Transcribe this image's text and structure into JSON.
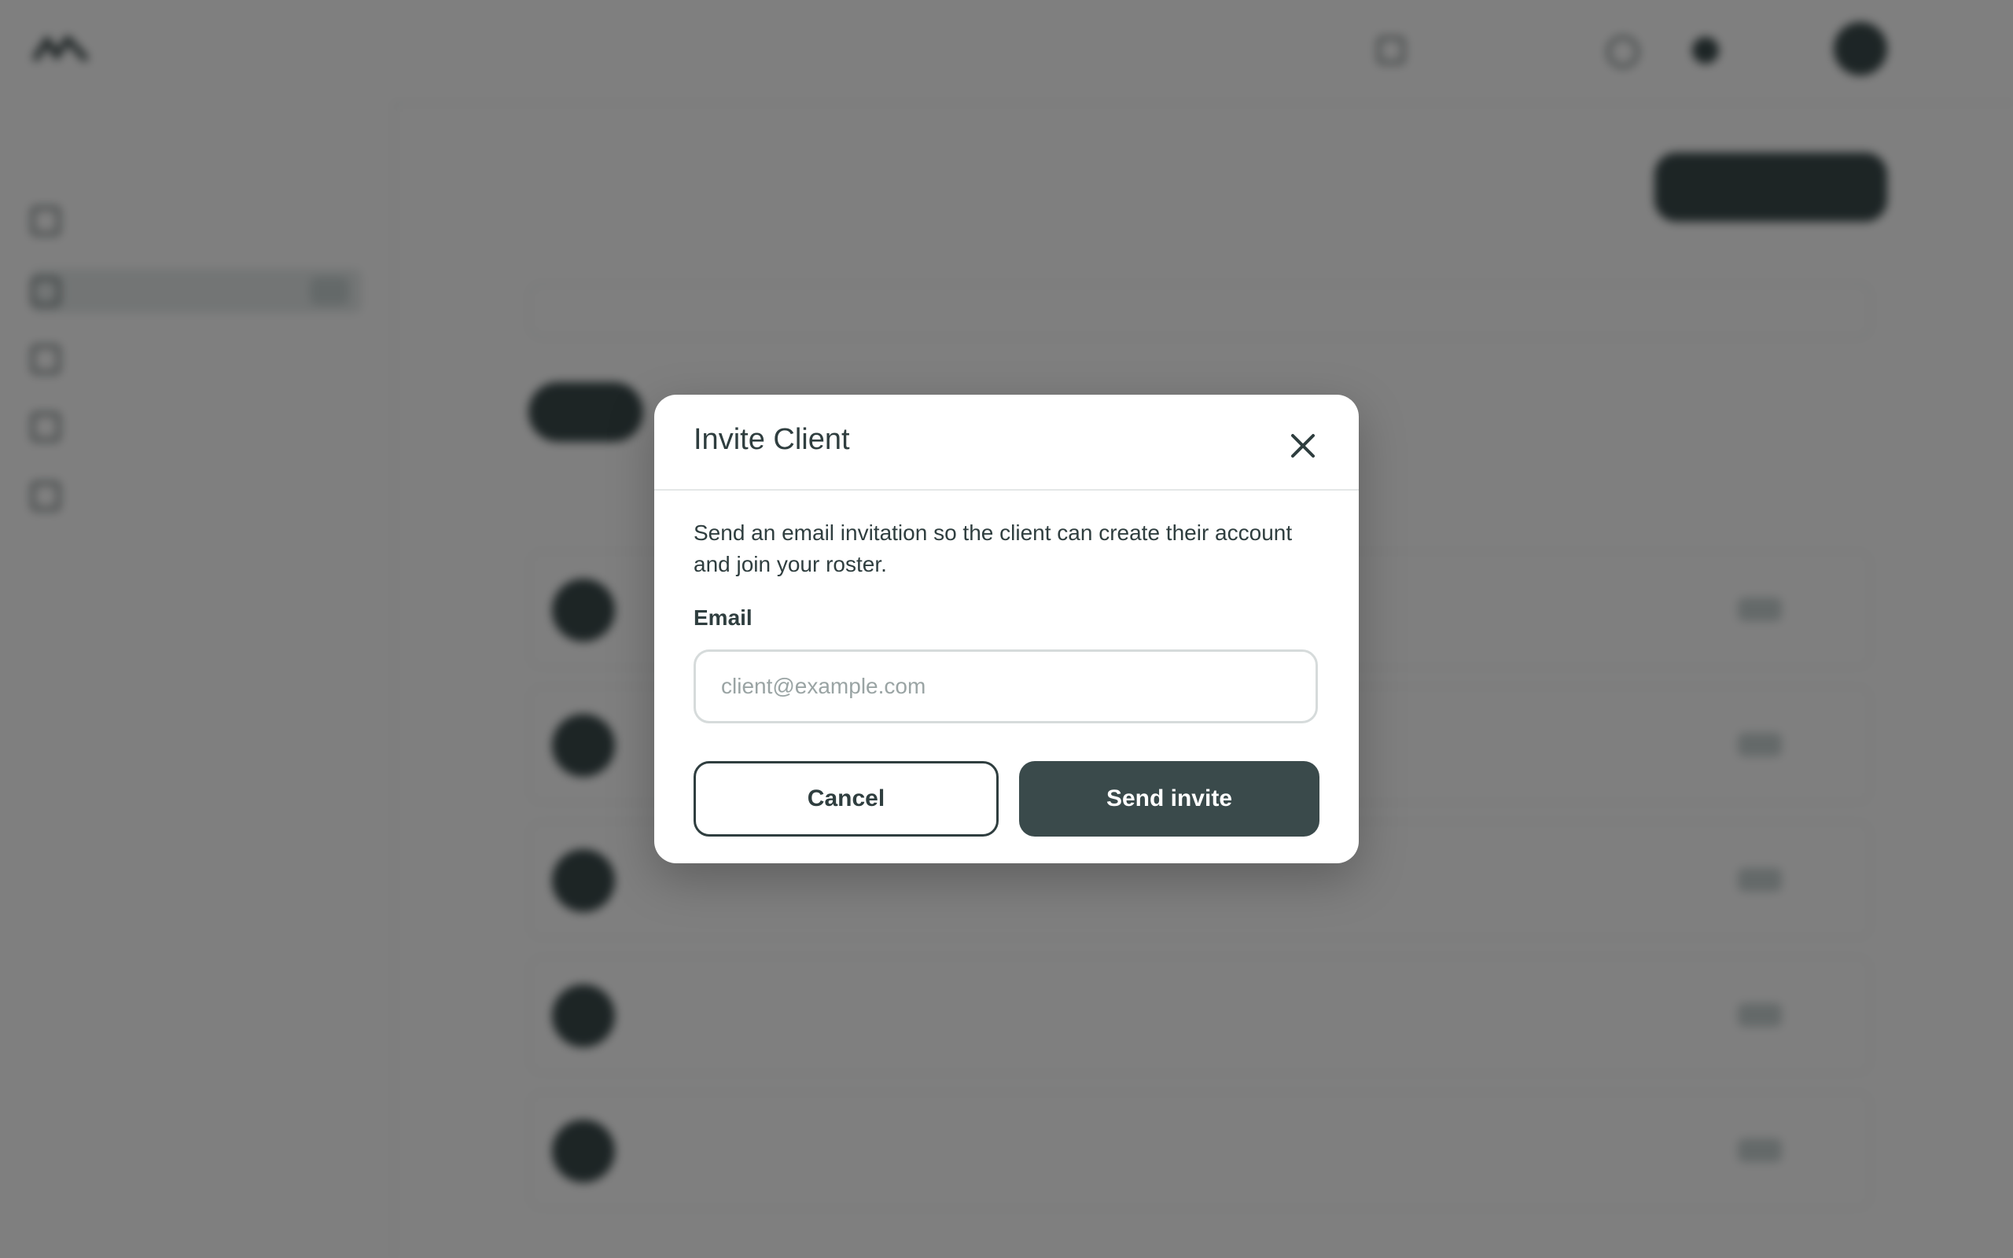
{
  "modal": {
    "title": "Invite Client",
    "close_icon": "close-icon",
    "description": "Send an email invitation so the client can create their account and join your roster.",
    "email_label": "Email",
    "email_placeholder": "client@example.com",
    "email_value": "",
    "cancel_label": "Cancel",
    "send_label": "Send invite"
  },
  "colors": {
    "primary": "#3a4a4b",
    "text": "#2f3e3f",
    "overlay": "rgba(0,0,0,0.5)"
  }
}
